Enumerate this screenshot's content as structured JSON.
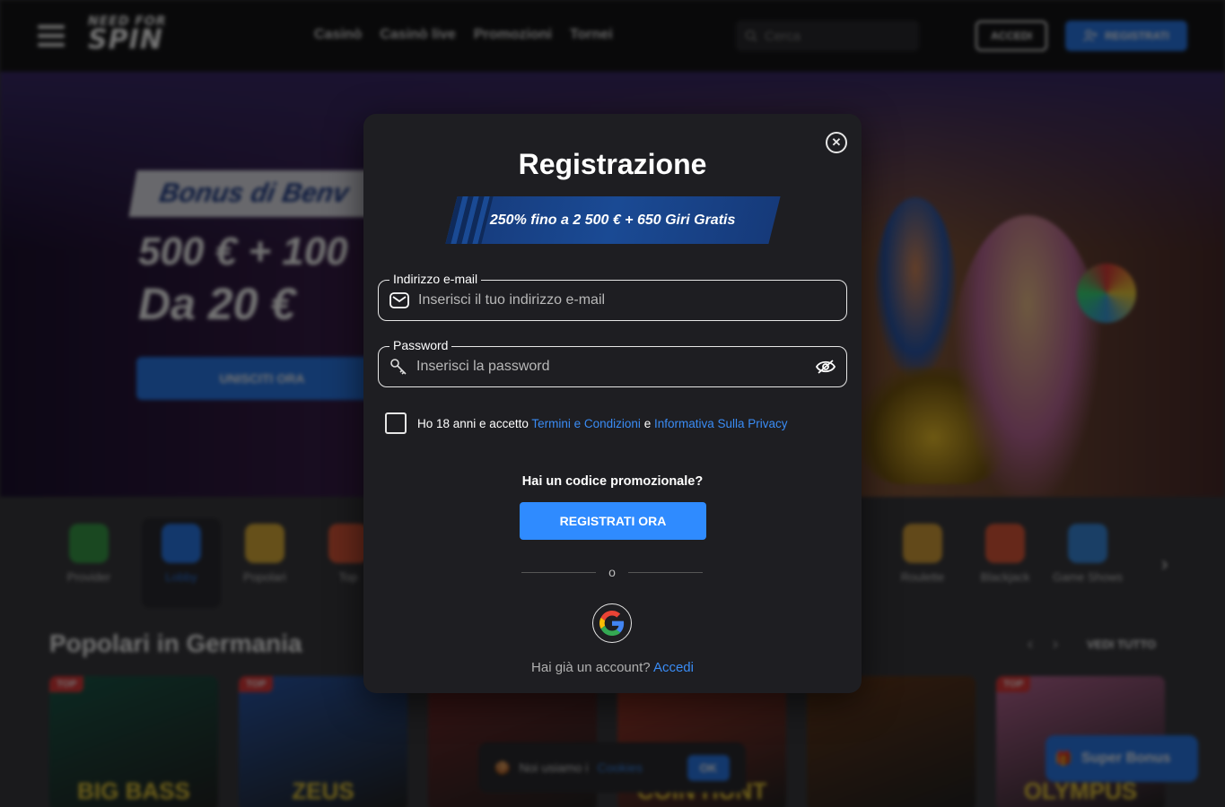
{
  "header": {
    "logo_line1": "NEED FOR",
    "logo_line2": "SPIN",
    "nav": [
      "Casinò",
      "Casinò live",
      "Promozioni",
      "Tornei"
    ],
    "search_placeholder": "Cerca",
    "login_label": "ACCEDI",
    "register_label": "REGISTRATI"
  },
  "hero": {
    "banner": "Bonus di Benv",
    "line1": "500 € + 100",
    "line2": "Da 20 €",
    "cta": "UNISCITI ORA"
  },
  "categories": [
    {
      "label": "Provider",
      "color": "#3aa04a"
    },
    {
      "label": "Lobby",
      "color": "#2a7cf0"
    },
    {
      "label": "Popolari",
      "color": "#e2b23a"
    },
    {
      "label": "Top",
      "color": "#e25a3a"
    },
    {
      "label": "Roulette",
      "color": "#d9a23a"
    },
    {
      "label": "Blackjack",
      "color": "#e25a3a"
    },
    {
      "label": "Game Shows",
      "color": "#3a8ce2"
    }
  ],
  "section": {
    "title": "Popolari in Germania",
    "view_all": "VEDI TUTTO"
  },
  "games": [
    {
      "badge": "TOP",
      "title": "BIG BASS",
      "color": "#1a5a4a"
    },
    {
      "badge": "TOP",
      "title": "ZEUS",
      "color": "#2a5ab0"
    },
    {
      "badge": "",
      "title": "",
      "color": "#7a2a2a"
    },
    {
      "badge": "",
      "title": "COIN HUNT",
      "color": "#b03a2a"
    },
    {
      "badge": "",
      "title": "",
      "color": "#6a3a1a"
    },
    {
      "badge": "TOP",
      "title": "OLYMPUS",
      "color": "#c06a9a"
    }
  ],
  "cookie": {
    "text": "Noi usiamo i",
    "link": "Cookies",
    "ok": "OK"
  },
  "super_bonus": "Super Bonus",
  "modal": {
    "title": "Registrazione",
    "bonus_banner": "250% fino a 2 500 € + 650 Giri Gratis",
    "email_label": "Indirizzo e-mail",
    "email_placeholder": "Inserisci il tuo indirizzo e-mail",
    "password_label": "Password",
    "password_placeholder": "Inserisci la password",
    "terms_prefix": "Ho 18 anni e accetto",
    "terms_link": "Termini e Condizioni",
    "terms_and": "e",
    "privacy_link": "Informativa Sulla Privacy",
    "promo_question": "Hai un codice promozionale?",
    "submit": "REGISTRATI ORA",
    "or": "o",
    "have_account": "Hai già un account?",
    "login_link": "Accedi"
  },
  "colors": {
    "accent": "#2f8bff",
    "link": "#3a8cf5",
    "modal_bg": "#1e1e22",
    "banner": "#1a4a94"
  }
}
